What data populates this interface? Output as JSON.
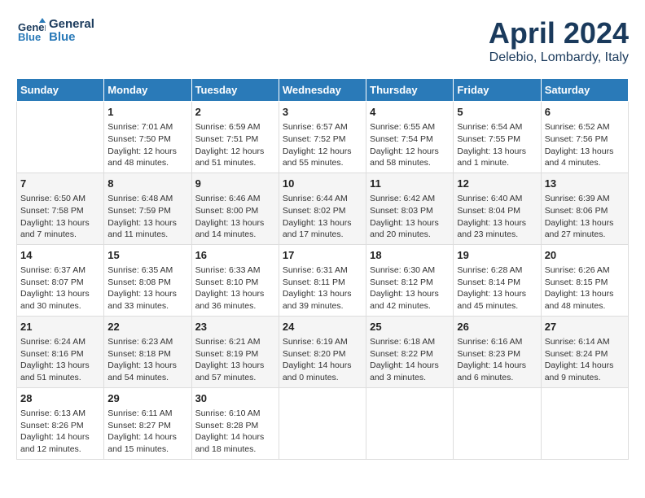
{
  "header": {
    "logo_line1": "General",
    "logo_line2": "Blue",
    "month": "April 2024",
    "location": "Delebio, Lombardy, Italy"
  },
  "days_of_week": [
    "Sunday",
    "Monday",
    "Tuesday",
    "Wednesday",
    "Thursday",
    "Friday",
    "Saturday"
  ],
  "weeks": [
    [
      {
        "day": "",
        "info": ""
      },
      {
        "day": "1",
        "info": "Sunrise: 7:01 AM\nSunset: 7:50 PM\nDaylight: 12 hours\nand 48 minutes."
      },
      {
        "day": "2",
        "info": "Sunrise: 6:59 AM\nSunset: 7:51 PM\nDaylight: 12 hours\nand 51 minutes."
      },
      {
        "day": "3",
        "info": "Sunrise: 6:57 AM\nSunset: 7:52 PM\nDaylight: 12 hours\nand 55 minutes."
      },
      {
        "day": "4",
        "info": "Sunrise: 6:55 AM\nSunset: 7:54 PM\nDaylight: 12 hours\nand 58 minutes."
      },
      {
        "day": "5",
        "info": "Sunrise: 6:54 AM\nSunset: 7:55 PM\nDaylight: 13 hours\nand 1 minute."
      },
      {
        "day": "6",
        "info": "Sunrise: 6:52 AM\nSunset: 7:56 PM\nDaylight: 13 hours\nand 4 minutes."
      }
    ],
    [
      {
        "day": "7",
        "info": "Sunrise: 6:50 AM\nSunset: 7:58 PM\nDaylight: 13 hours\nand 7 minutes."
      },
      {
        "day": "8",
        "info": "Sunrise: 6:48 AM\nSunset: 7:59 PM\nDaylight: 13 hours\nand 11 minutes."
      },
      {
        "day": "9",
        "info": "Sunrise: 6:46 AM\nSunset: 8:00 PM\nDaylight: 13 hours\nand 14 minutes."
      },
      {
        "day": "10",
        "info": "Sunrise: 6:44 AM\nSunset: 8:02 PM\nDaylight: 13 hours\nand 17 minutes."
      },
      {
        "day": "11",
        "info": "Sunrise: 6:42 AM\nSunset: 8:03 PM\nDaylight: 13 hours\nand 20 minutes."
      },
      {
        "day": "12",
        "info": "Sunrise: 6:40 AM\nSunset: 8:04 PM\nDaylight: 13 hours\nand 23 minutes."
      },
      {
        "day": "13",
        "info": "Sunrise: 6:39 AM\nSunset: 8:06 PM\nDaylight: 13 hours\nand 27 minutes."
      }
    ],
    [
      {
        "day": "14",
        "info": "Sunrise: 6:37 AM\nSunset: 8:07 PM\nDaylight: 13 hours\nand 30 minutes."
      },
      {
        "day": "15",
        "info": "Sunrise: 6:35 AM\nSunset: 8:08 PM\nDaylight: 13 hours\nand 33 minutes."
      },
      {
        "day": "16",
        "info": "Sunrise: 6:33 AM\nSunset: 8:10 PM\nDaylight: 13 hours\nand 36 minutes."
      },
      {
        "day": "17",
        "info": "Sunrise: 6:31 AM\nSunset: 8:11 PM\nDaylight: 13 hours\nand 39 minutes."
      },
      {
        "day": "18",
        "info": "Sunrise: 6:30 AM\nSunset: 8:12 PM\nDaylight: 13 hours\nand 42 minutes."
      },
      {
        "day": "19",
        "info": "Sunrise: 6:28 AM\nSunset: 8:14 PM\nDaylight: 13 hours\nand 45 minutes."
      },
      {
        "day": "20",
        "info": "Sunrise: 6:26 AM\nSunset: 8:15 PM\nDaylight: 13 hours\nand 48 minutes."
      }
    ],
    [
      {
        "day": "21",
        "info": "Sunrise: 6:24 AM\nSunset: 8:16 PM\nDaylight: 13 hours\nand 51 minutes."
      },
      {
        "day": "22",
        "info": "Sunrise: 6:23 AM\nSunset: 8:18 PM\nDaylight: 13 hours\nand 54 minutes."
      },
      {
        "day": "23",
        "info": "Sunrise: 6:21 AM\nSunset: 8:19 PM\nDaylight: 13 hours\nand 57 minutes."
      },
      {
        "day": "24",
        "info": "Sunrise: 6:19 AM\nSunset: 8:20 PM\nDaylight: 14 hours\nand 0 minutes."
      },
      {
        "day": "25",
        "info": "Sunrise: 6:18 AM\nSunset: 8:22 PM\nDaylight: 14 hours\nand 3 minutes."
      },
      {
        "day": "26",
        "info": "Sunrise: 6:16 AM\nSunset: 8:23 PM\nDaylight: 14 hours\nand 6 minutes."
      },
      {
        "day": "27",
        "info": "Sunrise: 6:14 AM\nSunset: 8:24 PM\nDaylight: 14 hours\nand 9 minutes."
      }
    ],
    [
      {
        "day": "28",
        "info": "Sunrise: 6:13 AM\nSunset: 8:26 PM\nDaylight: 14 hours\nand 12 minutes."
      },
      {
        "day": "29",
        "info": "Sunrise: 6:11 AM\nSunset: 8:27 PM\nDaylight: 14 hours\nand 15 minutes."
      },
      {
        "day": "30",
        "info": "Sunrise: 6:10 AM\nSunset: 8:28 PM\nDaylight: 14 hours\nand 18 minutes."
      },
      {
        "day": "",
        "info": ""
      },
      {
        "day": "",
        "info": ""
      },
      {
        "day": "",
        "info": ""
      },
      {
        "day": "",
        "info": ""
      }
    ]
  ]
}
